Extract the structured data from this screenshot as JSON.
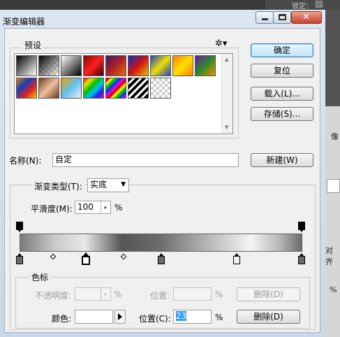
{
  "background": {
    "lock_label": "锁定：",
    "panel_text_1": "像",
    "panel_text_2": "对齐",
    "panel_text_3": "%"
  },
  "window": {
    "title": "渐变编辑器"
  },
  "presets": {
    "label": "预设",
    "gear_icon": "gear-icon"
  },
  "buttons": {
    "ok": "确定",
    "reset": "复位",
    "load": "载入(L)...",
    "save": "存储(S)...",
    "new": "新建(W)",
    "delete_opacity": "删除(D)",
    "delete_color": "删除(D)"
  },
  "name": {
    "label": "名称(N):",
    "value": "自定"
  },
  "gradient": {
    "type_label": "渐变类型(T):",
    "type_value": "实底",
    "smoothness_label": "平滑度(M):",
    "smoothness_value": "100",
    "smoothness_unit": "%"
  },
  "stops_group": {
    "label": "色标",
    "opacity_label": "不透明度:",
    "opacity_value": "",
    "opacity_unit": "%",
    "opacity_position_label": "位置:",
    "opacity_position_value": "",
    "opacity_position_unit": "%",
    "color_label": "颜色:",
    "color_position_label": "位置(C):",
    "color_position_value": "23",
    "color_position_unit": "%"
  },
  "colors": {
    "dialog_bg": "#f0f0f0",
    "primary_button": "#bee6fd",
    "selection": "#3399ff"
  }
}
